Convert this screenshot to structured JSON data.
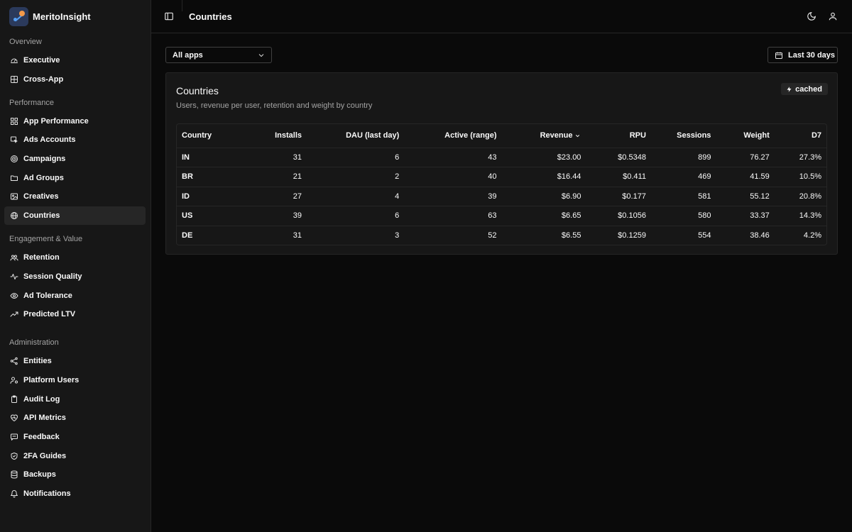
{
  "brand": {
    "name": "MeritoInsight"
  },
  "sidebar": {
    "groups": [
      {
        "label": "Overview",
        "items": [
          {
            "label": "Executive",
            "icon": "gauge-icon"
          },
          {
            "label": "Cross-App",
            "icon": "grid-icon"
          }
        ]
      },
      {
        "label": "Performance",
        "items": [
          {
            "label": "App Performance",
            "icon": "layout-grid-icon"
          },
          {
            "label": "Ads Accounts",
            "icon": "pointer-icon"
          },
          {
            "label": "Campaigns",
            "icon": "target-icon"
          },
          {
            "label": "Ad Groups",
            "icon": "folder-icon"
          },
          {
            "label": "Creatives",
            "icon": "image-icon"
          },
          {
            "label": "Countries",
            "icon": "globe-icon",
            "active": true
          }
        ]
      },
      {
        "label": "Engagement & Value",
        "items": [
          {
            "label": "Retention",
            "icon": "users-icon"
          },
          {
            "label": "Session Quality",
            "icon": "activity-icon"
          },
          {
            "label": "Ad Tolerance",
            "icon": "eye-icon"
          },
          {
            "label": "Predicted LTV",
            "icon": "trending-up-icon"
          }
        ]
      },
      {
        "label": "Administration",
        "items": [
          {
            "label": "Entities",
            "icon": "network-icon"
          },
          {
            "label": "Platform Users",
            "icon": "user-cog-icon"
          },
          {
            "label": "Audit Log",
            "icon": "clipboard-icon"
          },
          {
            "label": "API Metrics",
            "icon": "heart-pulse-icon"
          },
          {
            "label": "Feedback",
            "icon": "message-icon"
          },
          {
            "label": "2FA Guides",
            "icon": "shield-check-icon"
          },
          {
            "label": "Backups",
            "icon": "database-icon"
          },
          {
            "label": "Notifications",
            "icon": "bell-icon"
          }
        ]
      }
    ]
  },
  "header": {
    "title": "Countries"
  },
  "filters": {
    "app_select": "All apps",
    "date_range": "Last 30 days"
  },
  "card": {
    "title": "Countries",
    "subtitle": "Users, revenue per user, retention and weight by country",
    "badge": "cached"
  },
  "table": {
    "columns": [
      "Country",
      "Installs",
      "DAU (last day)",
      "Active (range)",
      "Revenue",
      "RPU",
      "Sessions",
      "Weight",
      "D7"
    ],
    "sorted_column": "Revenue",
    "rows": [
      [
        "IN",
        "31",
        "6",
        "43",
        "$23.00",
        "$0.5348",
        "899",
        "76.27",
        "27.3%"
      ],
      [
        "BR",
        "21",
        "2",
        "40",
        "$16.44",
        "$0.411",
        "469",
        "41.59",
        "10.5%"
      ],
      [
        "ID",
        "27",
        "4",
        "39",
        "$6.90",
        "$0.177",
        "581",
        "55.12",
        "20.8%"
      ],
      [
        "US",
        "39",
        "6",
        "63",
        "$6.65",
        "$0.1056",
        "580",
        "33.37",
        "14.3%"
      ],
      [
        "DE",
        "31",
        "3",
        "52",
        "$6.55",
        "$0.1259",
        "554",
        "38.46",
        "4.2%"
      ]
    ]
  }
}
